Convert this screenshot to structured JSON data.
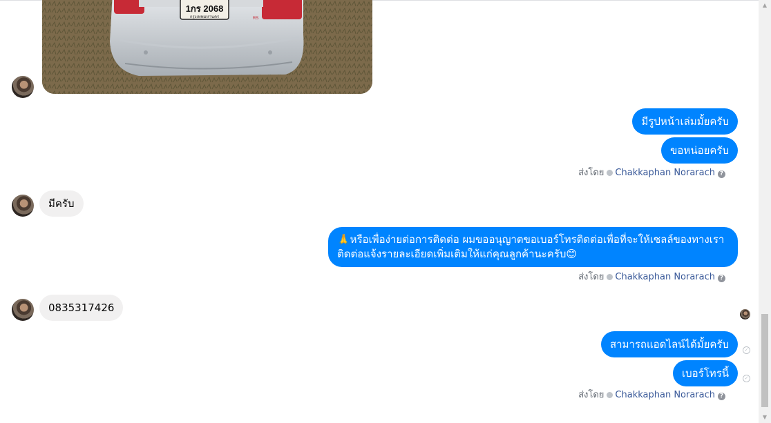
{
  "thread": {
    "photo": {
      "plate_text": "1กร 2068",
      "plate_province": "กรุงเทพมหานคร",
      "badge_text": "RS"
    },
    "messages": [
      {
        "text": "มีรูปหน้าเล่มมั้ยครับ"
      },
      {
        "text": "ขอหน่อยครับ"
      },
      {
        "text": "มีครับ"
      },
      {
        "line1": "🙏หรือเพื่อง่ายต่อการติดต่อ ผมขออนุญาตขอเบอร์โทรติดต่อเพื่อที่จะให้เซลล์ของทางเรา",
        "line2": "ติดต่อแจ้งรายละเอียดเพิ่มเติมให้แก่คุณลูกค้านะครับ😊"
      },
      {
        "text": "0835317426"
      },
      {
        "text": "สามารถแอดไลน์ได้มั้ยครับ"
      },
      {
        "text": "เบอร์โทรนี้"
      }
    ],
    "sent_by_prefix": "ส่งโดย",
    "sender_name": "Chakkaphan Norarach",
    "help_glyph": "?",
    "check_glyph": "✓"
  },
  "colors": {
    "outgoing": "#0084ff",
    "incoming": "#f1f0f0",
    "link": "#385898"
  }
}
